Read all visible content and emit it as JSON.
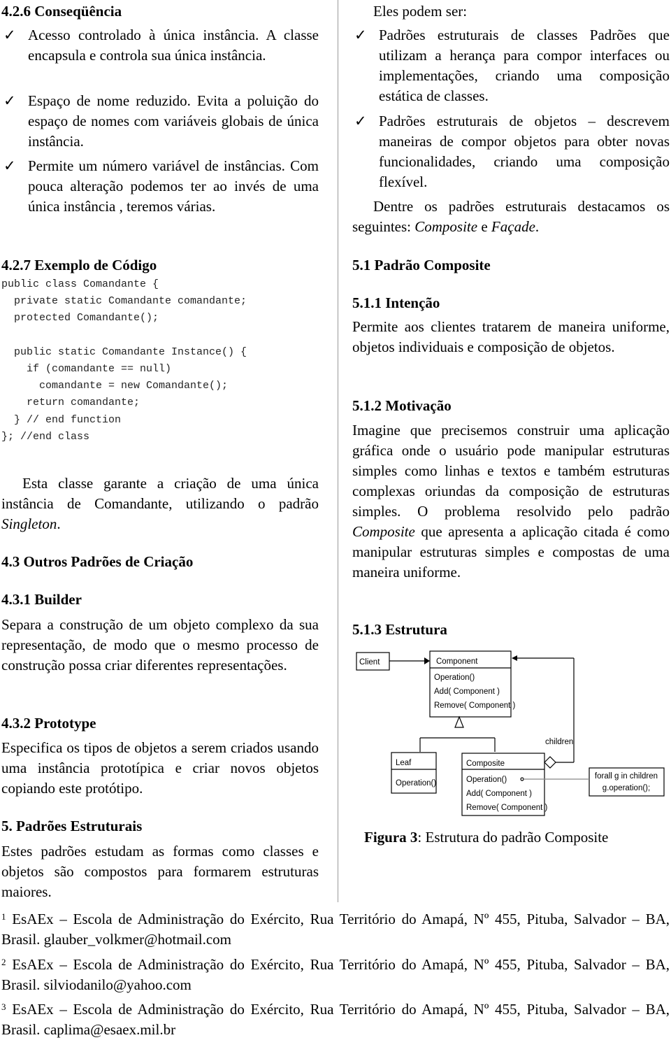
{
  "left": {
    "h426": "4.2.6 Conseqüência",
    "consequences": [
      "Acesso controlado à única instância. A classe encapsula e controla sua única instância.",
      "Espaço de nome reduzido. Evita a poluição do espaço de nomes com variáveis globais de única instância.",
      "Permite um número variável de instâncias. Com pouca alteração podemos ter ao invés de uma única instância , teremos várias."
    ],
    "h427": "4.2.7 Exemplo de Código",
    "code": [
      "public class Comandante {",
      "  private static Comandante comandante;",
      "  protected Comandante();",
      "",
      "  public static Comandante Instance() {",
      "    if (comandante == null)",
      "      comandante = new Comandante();",
      "    return comandante;",
      "  } // end function",
      "}; //end class"
    ],
    "p_singleton": "Esta classe garante a criação de uma única instância de Comandante, utilizando o padrão ",
    "p_singleton_italic": "Singleton",
    "p_singleton_end": ".",
    "h43": "4.3 Outros Padrões de Criação",
    "h431": "4.3.1 Builder",
    "p_builder": "Separa a construção de um objeto complexo da sua representação, de modo que o mesmo processo de construção possa criar diferentes representações.",
    "h432": "4.3.2 Prototype",
    "p_prototype": "Especifica os tipos de objetos a serem criados usando uma instância prototípica e criar novos objetos copiando este protótipo.",
    "h5": "5. Padrões Estruturais",
    "p_estruturais": "Estes padrões estudam as formas como classes e objetos são compostos para formarem estruturas maiores."
  },
  "right": {
    "intro": "Eles podem ser:",
    "items": [
      "Padrões estruturais de classes Padrões que utilizam a herança para compor interfaces ou implementações, criando uma composição estática de classes.",
      "Padrões estruturais de objetos – descrevem maneiras de compor objetos para obter novas funcionalidades, criando uma composição flexível."
    ],
    "p_dentre": "Dentre os padrões estruturais destacamos os seguintes: ",
    "p_dentre_i1": "Composite",
    "p_dentre_e": " e ",
    "p_dentre_i2": "Façade",
    "p_dentre_end": ".",
    "h51": "5.1 Padrão Composite",
    "h511": "5.1.1 Intenção",
    "p_intencao": "Permite aos clientes tratarem de maneira uniforme, objetos individuais e composição de objetos.",
    "h512": "5.1.2 Motivação",
    "p_motivacao": "Imagine que precisemos construir uma aplicação gráfica onde o usuário pode manipular estruturas simples como linhas e textos e também estruturas complexas oriundas da composição de estruturas simples. O problema resolvido pelo padrão ",
    "p_motivacao_i": "Composite",
    "p_motivacao_end": " que apresenta a aplicação citada é como manipular estruturas simples e compostas de uma maneira uniforme.",
    "h513": "5.1.3 Estrutura",
    "diagram": {
      "client": "Client",
      "component": "Component",
      "component_ops": [
        "Operation()",
        "Add( Component )",
        "Remove( Component )"
      ],
      "leaf": "Leaf",
      "leaf_ops": [
        "Operation()"
      ],
      "composite": "Composite",
      "composite_ops": [
        "Operation()",
        "Add( Component )",
        "Remove( Component )"
      ],
      "children": "children",
      "note": [
        "forall g in children",
        "g.operation();"
      ]
    },
    "caption_bold": "Figura 3",
    "caption": ": Estrutura do padrão Composite"
  },
  "footnotes": [
    {
      "num": "1",
      "text": "EsAEx – Escola de Administração do Exército, Rua Território do Amapá, Nº 455, Pituba, Salvador – BA, Brasil. glauber_volkmer@hotmail.com"
    },
    {
      "num": "2",
      "text": "EsAEx – Escola de Administração do Exército, Rua Território do Amapá, Nº 455, Pituba, Salvador – BA, Brasil. silviodanilo@yahoo.com"
    },
    {
      "num": "3",
      "text": "EsAEx – Escola de Administração do Exército, Rua Território do Amapá, Nº 455, Pituba, Salvador – BA, Brasil. caplima@esaex.mil.br"
    }
  ]
}
